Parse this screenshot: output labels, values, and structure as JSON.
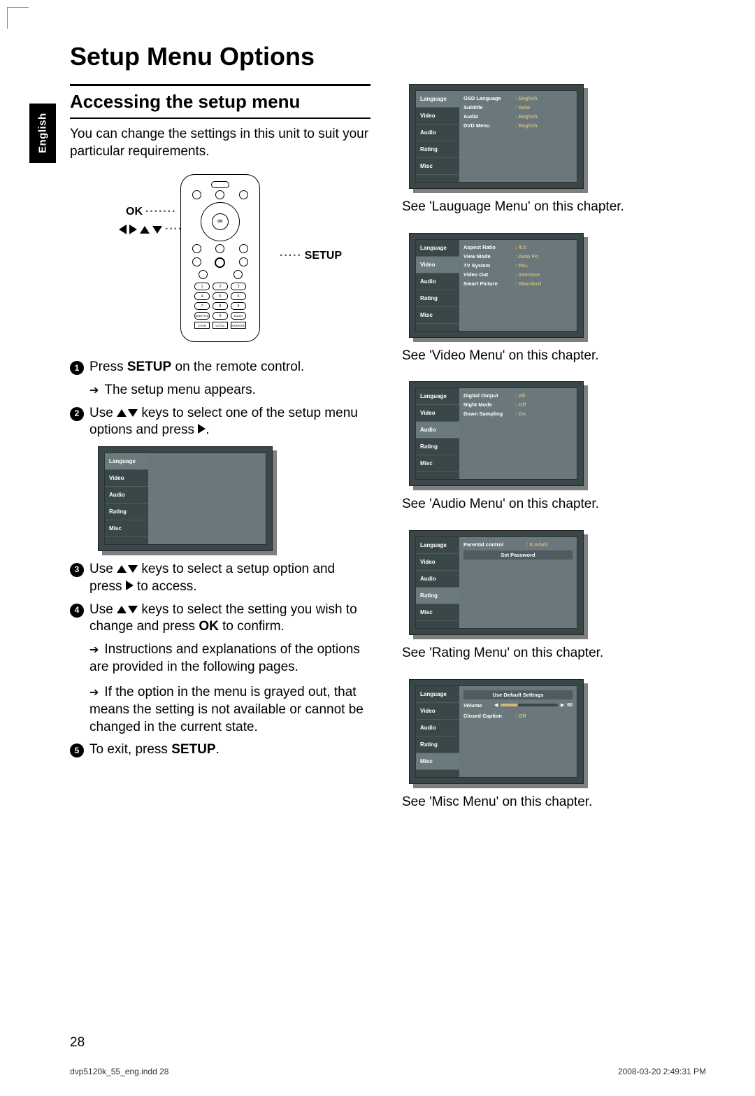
{
  "tab_label": "English",
  "title": "Setup Menu Options",
  "section_heading": "Accessing the setup menu",
  "intro": "You can change the settings in this unit to suit your particular requirements.",
  "remote": {
    "ok_label": "OK",
    "setup_label": "SETUP",
    "inner_ok": "OK"
  },
  "steps": {
    "s1a": "Press ",
    "s1b": "SETUP",
    "s1c": " on the remote control.",
    "s1_sub": "The setup menu appears.",
    "s2a": "Use ",
    "s2b": " keys to select one of the setup menu options and press ",
    "s2c": ".",
    "s3a": "Use ",
    "s3b": " keys to select a setup option and press ",
    "s3c": " to access.",
    "s4a": "Use ",
    "s4b": " keys to select the setting you wish to change and press ",
    "s4_ok": "OK",
    "s4c": " to confirm.",
    "s4_sub1": "Instructions and explanations of the options are provided in the following pages.",
    "s4_sub2": "If the option in the menu is grayed out, that means the setting is not available or cannot be changed in the current state.",
    "s5a": "To exit, press ",
    "s5b": "SETUP",
    "s5c": "."
  },
  "tabs": [
    "Language",
    "Video",
    "Audio",
    "Rating",
    "Misc"
  ],
  "language_menu": {
    "rows": [
      {
        "lbl": "OSD Language",
        "val": "English"
      },
      {
        "lbl": "Subtitle",
        "val": "Auto"
      },
      {
        "lbl": "Audio",
        "val": "English"
      },
      {
        "lbl": "DVD Menu",
        "val": "English"
      }
    ],
    "ref": "See 'Lauguage Menu' on this chapter."
  },
  "video_menu": {
    "rows": [
      {
        "lbl": "Aspect Ratio",
        "val": "4:3"
      },
      {
        "lbl": "View Mode",
        "val": "Auto Fit"
      },
      {
        "lbl": "TV System",
        "val": "PAL"
      },
      {
        "lbl": "Video Out",
        "val": "Interlace"
      },
      {
        "lbl": "Smart Picture",
        "val": "Standard"
      }
    ],
    "ref": "See 'Video Menu' on this chapter."
  },
  "audio_menu": {
    "rows": [
      {
        "lbl": "Digital Output",
        "val": "All"
      },
      {
        "lbl": "Night  Mode",
        "val": "Off"
      },
      {
        "lbl": "Down Sampling",
        "val": "On"
      }
    ],
    "ref": "See 'Audio Menu' on this chapter."
  },
  "rating_menu": {
    "rows": [
      {
        "lbl": "Parental control",
        "val": "8.Adult"
      }
    ],
    "titlebar": "Set Password",
    "ref": "See 'Rating Menu' on this chapter."
  },
  "misc_menu": {
    "titlebar": "Use Default Settings",
    "volume_label": "Volume",
    "volume_value": "60",
    "cc_row": {
      "lbl": "Closed Caption",
      "val": "Off"
    },
    "ref": "See 'Misc Menu' on this chapter."
  },
  "page_number": "28",
  "footer_path": "dvp5120k_55_eng.indd   28",
  "footer_date": "2008-03-20   2:49:31 PM"
}
